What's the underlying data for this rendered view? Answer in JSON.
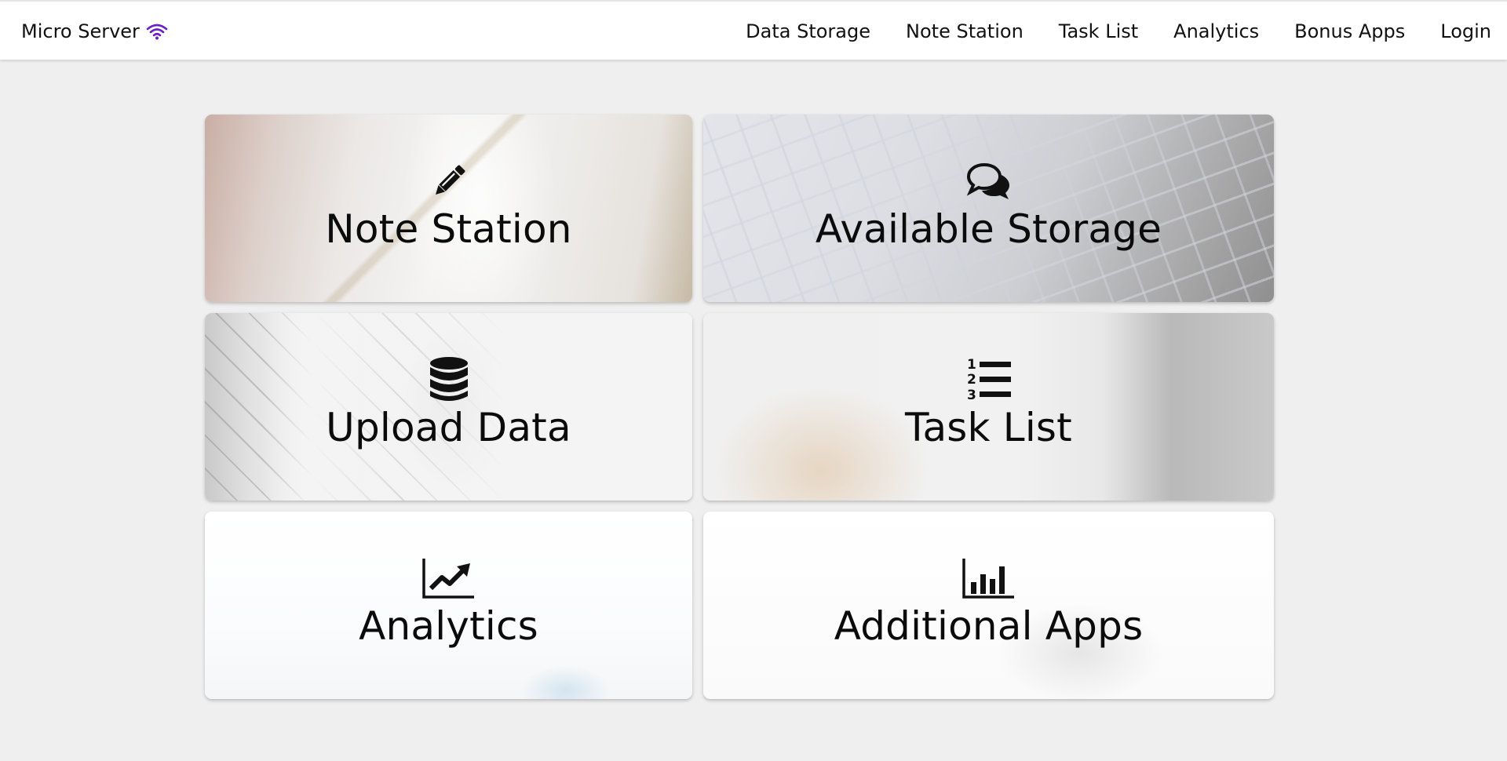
{
  "navbar": {
    "brand": "Micro Server",
    "brand_icon": "wifi-icon",
    "accent_color": "#6a1fc9",
    "links": [
      {
        "label": "Data Storage"
      },
      {
        "label": "Note Station"
      },
      {
        "label": "Task List"
      },
      {
        "label": "Analytics"
      },
      {
        "label": "Bonus Apps"
      },
      {
        "label": "Login"
      }
    ]
  },
  "tiles": [
    {
      "label": "Note Station",
      "icon": "pencil-icon"
    },
    {
      "label": "Available Storage",
      "icon": "comments-icon"
    },
    {
      "label": "Upload Data",
      "icon": "database-icon"
    },
    {
      "label": "Task List",
      "icon": "ordered-list-icon"
    },
    {
      "label": "Analytics",
      "icon": "line-chart-icon"
    },
    {
      "label": "Additional Apps",
      "icon": "bar-chart-icon"
    }
  ]
}
